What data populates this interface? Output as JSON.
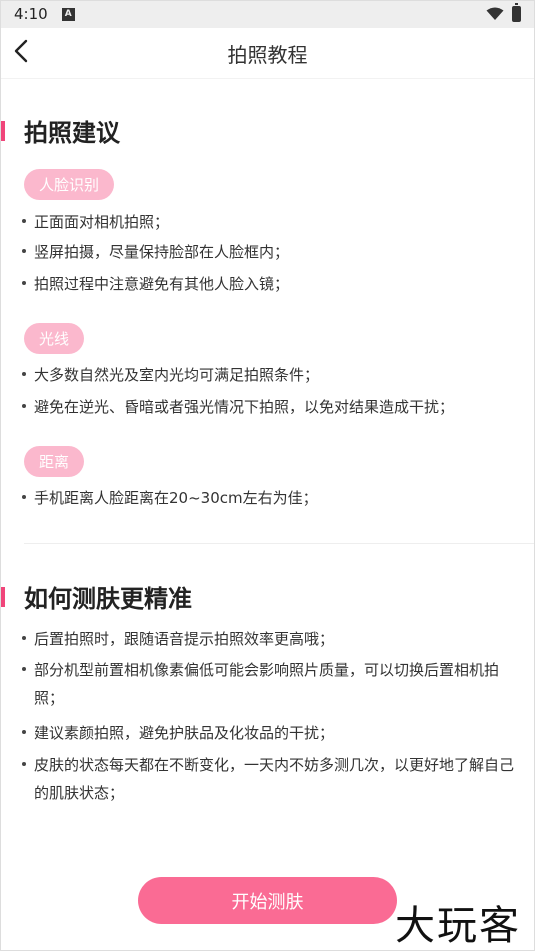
{
  "status_bar": {
    "time": "4:10",
    "indicator": "A"
  },
  "header": {
    "title": "拍照教程"
  },
  "sections": [
    {
      "title": "拍照建议",
      "groups": [
        {
          "tag": "人脸识别",
          "items": [
            "正面面对相机拍照；",
            "竖屏拍摄，尽量保持脸部在人脸框内；",
            "拍照过程中注意避免有其他人脸入镜；"
          ]
        },
        {
          "tag": "光线",
          "items": [
            "大多数自然光及室内光均可满足拍照条件；",
            "避免在逆光、昏暗或者强光情况下拍照，以免对结果造成干扰；"
          ]
        },
        {
          "tag": "距离",
          "items": [
            "手机距离人脸距离在20~30cm左右为佳；"
          ]
        }
      ]
    },
    {
      "title": "如何测肤更精准",
      "items": [
        "后置拍照时，跟随语音提示拍照效率更高哦；",
        "部分机型前置相机像素偏低可能会影响照片质量，可以切换后置相机拍照；",
        "建议素颜拍照，避免护肤品及化妆品的干扰；",
        "皮肤的状态每天都在不断变化，一天内不妨多测几次，以更好地了解自己的肌肤状态；"
      ]
    }
  ],
  "button": {
    "start": "开始测肤"
  },
  "watermark": "大玩客",
  "colors": {
    "accent": "#fa6b94",
    "tag": "#fbb8cd",
    "section_bar": "#f0457a"
  }
}
